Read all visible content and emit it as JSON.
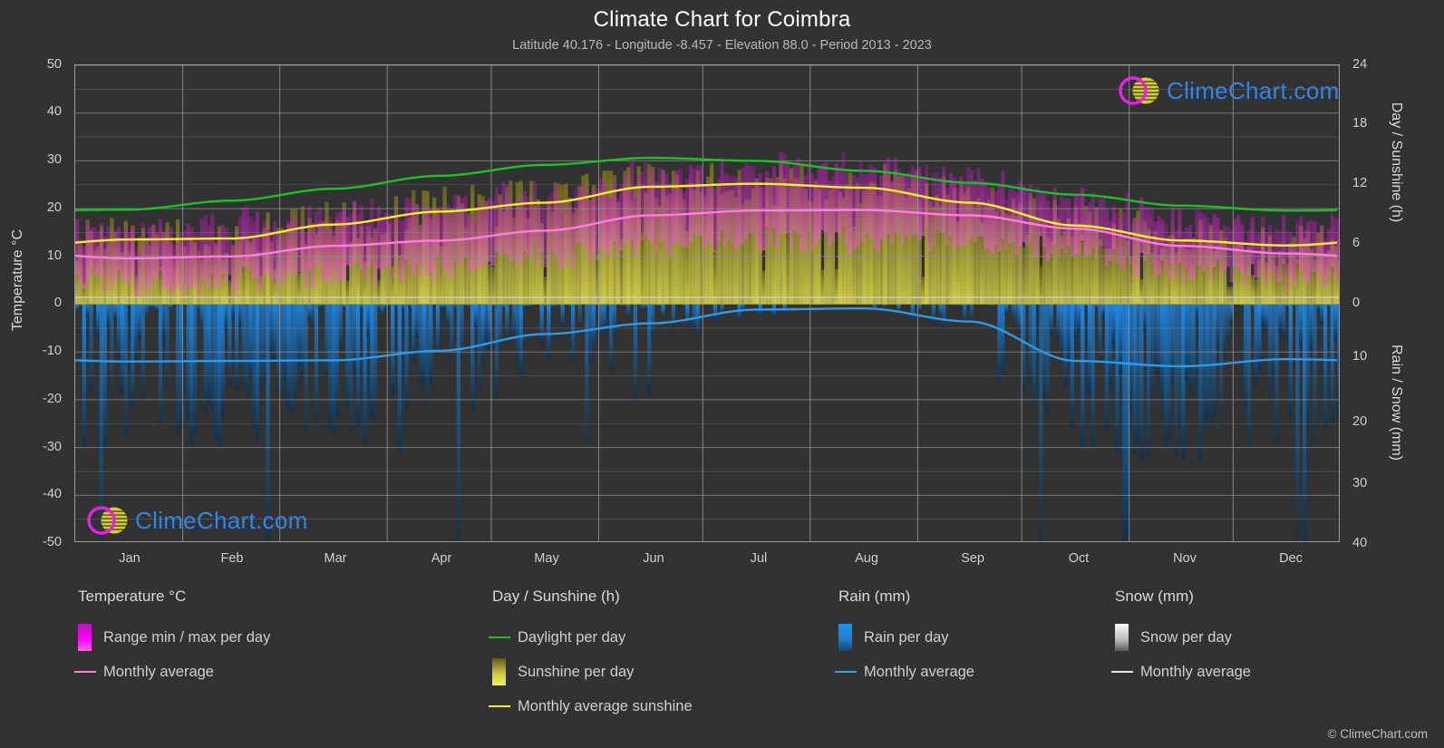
{
  "header": {
    "title": "Climate Chart for Coimbra",
    "subtitle": "Latitude 40.176 - Longitude -8.457 - Elevation 88.0 - Period 2013 - 2023"
  },
  "axes": {
    "left_title": "Temperature °C",
    "right_title_top": "Day / Sunshine (h)",
    "right_title_bottom": "Rain / Snow (mm)",
    "left_ticks": [
      "50",
      "40",
      "30",
      "20",
      "10",
      "0",
      "-10",
      "-20",
      "-30",
      "-40",
      "-50"
    ],
    "right_ticks_top": [
      "24",
      "18",
      "12",
      "6",
      "0"
    ],
    "right_ticks_bottom": [
      "10",
      "20",
      "30",
      "40"
    ],
    "x_ticks": [
      "Jan",
      "Feb",
      "Mar",
      "Apr",
      "May",
      "Jun",
      "Jul",
      "Aug",
      "Sep",
      "Oct",
      "Nov",
      "Dec"
    ]
  },
  "legend": {
    "temperature": {
      "heading": "Temperature °C",
      "items": [
        {
          "label": "Range min / max per day",
          "marker": "gradient-swatch",
          "color": "#ff00ff"
        },
        {
          "label": "Monthly average",
          "marker": "line",
          "color": "#ff7de0"
        }
      ]
    },
    "day_sunshine": {
      "heading": "Day / Sunshine (h)",
      "items": [
        {
          "label": "Daylight per day",
          "marker": "line",
          "color": "#17c423"
        },
        {
          "label": "Sunshine per day",
          "marker": "gradient-swatch",
          "color": "#f2ef4e"
        },
        {
          "label": "Monthly average sunshine",
          "marker": "line",
          "color": "#f5f02a"
        }
      ]
    },
    "rain": {
      "heading": "Rain (mm)",
      "items": [
        {
          "label": "Rain per day",
          "marker": "gradient-swatch",
          "color": "#1a88e8"
        },
        {
          "label": "Monthly average",
          "marker": "line",
          "color": "#3aa0ec"
        }
      ]
    },
    "snow": {
      "heading": "Snow (mm)",
      "items": [
        {
          "label": "Snow per day",
          "marker": "gradient-swatch",
          "color": "#f2f2f2"
        },
        {
          "label": "Monthly average",
          "marker": "line",
          "color": "#e8e8e8"
        }
      ]
    }
  },
  "watermark": {
    "text": "ClimeChart.com"
  },
  "footer": {
    "copyright": "© ClimeChart.com"
  },
  "colors": {
    "background": "#323232",
    "grid": "#8c8c8c",
    "axis": "#9a9a9a",
    "daylight": "#17c423",
    "sunshine_avg": "#f5f02a",
    "temp_avg": "#ff7de0",
    "temp_range": "#c020c0",
    "rain": "#1a88e8",
    "rain_avg": "#2e9ae8",
    "snow": "#ededed"
  },
  "chart_data": {
    "type": "line",
    "title": "Climate Chart for Coimbra",
    "subtitle": "Latitude 40.176 - Longitude -8.457 - Elevation 88.0 - Period 2013 - 2023",
    "xlabel": "",
    "ylabel": "Temperature °C",
    "ylim": [
      -50,
      50
    ],
    "y2lim_day_sunshine_h": [
      0,
      24
    ],
    "y2lim_rain_snow_mm": [
      0,
      40
    ],
    "grid": true,
    "legend_position": "below",
    "categories": [
      "Jan",
      "Feb",
      "Mar",
      "Apr",
      "May",
      "Jun",
      "Jul",
      "Aug",
      "Sep",
      "Oct",
      "Nov",
      "Dec"
    ],
    "series": [
      {
        "name": "Monthly average temperature (°C)",
        "axis": "left",
        "color": "#ff7de0",
        "values": [
          9.6,
          10.0,
          12.2,
          13.3,
          15.4,
          18.6,
          19.6,
          19.7,
          18.6,
          15.8,
          12.2,
          10.6
        ]
      },
      {
        "name": "Daylight per day (h)",
        "axis": "right-top",
        "color": "#17c423",
        "values": [
          9.5,
          10.4,
          11.6,
          12.9,
          14.0,
          14.7,
          14.4,
          13.4,
          12.2,
          11.0,
          9.9,
          9.4
        ]
      },
      {
        "name": "Monthly average sunshine (h)",
        "axis": "right-top",
        "color": "#f5f02a",
        "values": [
          6.5,
          6.6,
          8.0,
          9.3,
          10.2,
          11.8,
          12.1,
          11.7,
          10.2,
          7.9,
          6.4,
          5.9
        ]
      },
      {
        "name": "Monthly average rain (mm)",
        "axis": "right-bottom",
        "color": "#2e9ae8",
        "values": [
          9.6,
          9.5,
          9.4,
          7.8,
          5.0,
          3.2,
          0.9,
          0.7,
          2.9,
          9.5,
          10.4,
          9.2
        ]
      },
      {
        "name": "Daily temperature range min (°C)",
        "axis": "left",
        "color": "#c020c0",
        "values": [
          4.5,
          4.7,
          6.4,
          7.5,
          9.6,
          12.4,
          13.4,
          13.5,
          12.6,
          10.5,
          7.0,
          5.6
        ]
      },
      {
        "name": "Daily temperature range max (°C)",
        "axis": "left",
        "color": "#c020c0",
        "values": [
          15.0,
          16.0,
          18.5,
          20.0,
          22.4,
          26.0,
          28.0,
          28.0,
          26.0,
          22.0,
          17.5,
          15.5
        ]
      },
      {
        "name": "Monthly average snow (mm)",
        "axis": "right-bottom",
        "color": "#ededed",
        "values": [
          0,
          0,
          0,
          0,
          0,
          0,
          0,
          0,
          0,
          0,
          0,
          0
        ]
      }
    ],
    "notes": "Daily scatter bands: magenta/purple vertical bars = daily temperature min/max range; olive-yellow vertical bars = daily sunshine hours; blue downward bars = daily rain in mm."
  }
}
